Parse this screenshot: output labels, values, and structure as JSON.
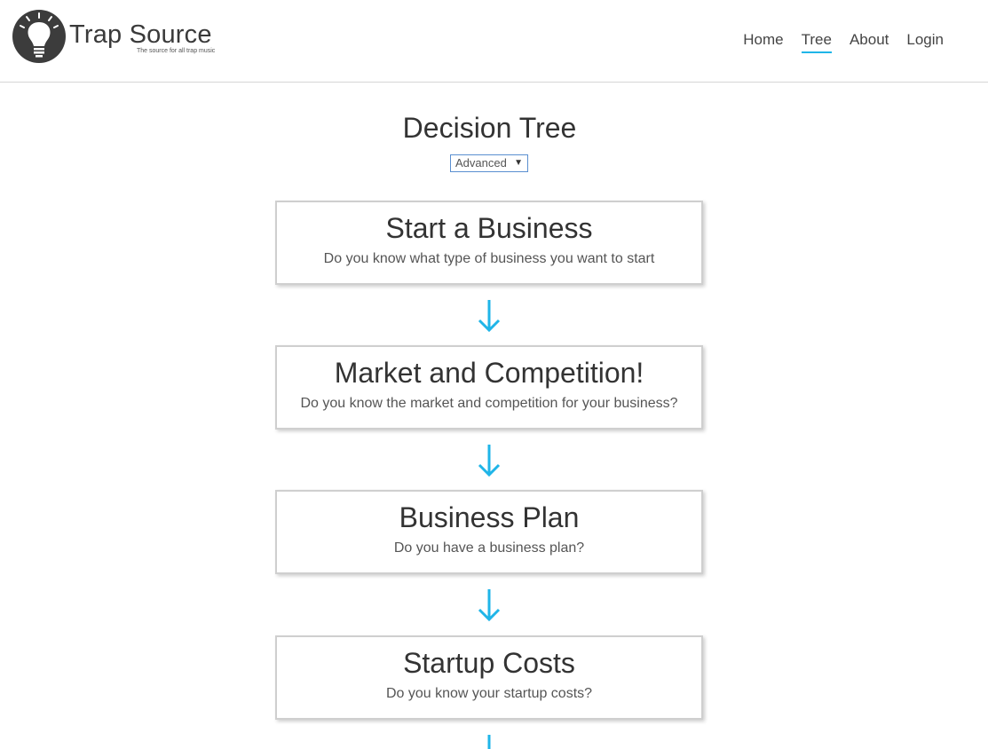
{
  "brand": {
    "name": "Trap Source",
    "tagline": "The source for all trap music"
  },
  "nav": {
    "items": [
      {
        "label": "Home",
        "active": false
      },
      {
        "label": "Tree",
        "active": true
      },
      {
        "label": "About",
        "active": false
      },
      {
        "label": "Login",
        "active": false
      }
    ]
  },
  "page": {
    "title": "Decision Tree",
    "mode_select": {
      "selected": "Advanced"
    }
  },
  "steps": [
    {
      "title": "Start a Business",
      "question": "Do you know what type of business you want to start"
    },
    {
      "title": "Market and Competition!",
      "question": "Do you know the market and competition for your business?"
    },
    {
      "title": "Business Plan",
      "question": "Do you have a business plan?"
    },
    {
      "title": "Startup Costs",
      "question": "Do you know your startup costs?"
    }
  ],
  "colors": {
    "accent": "#1fb5e8",
    "text": "#333333",
    "card_border": "#cfcfcf"
  }
}
